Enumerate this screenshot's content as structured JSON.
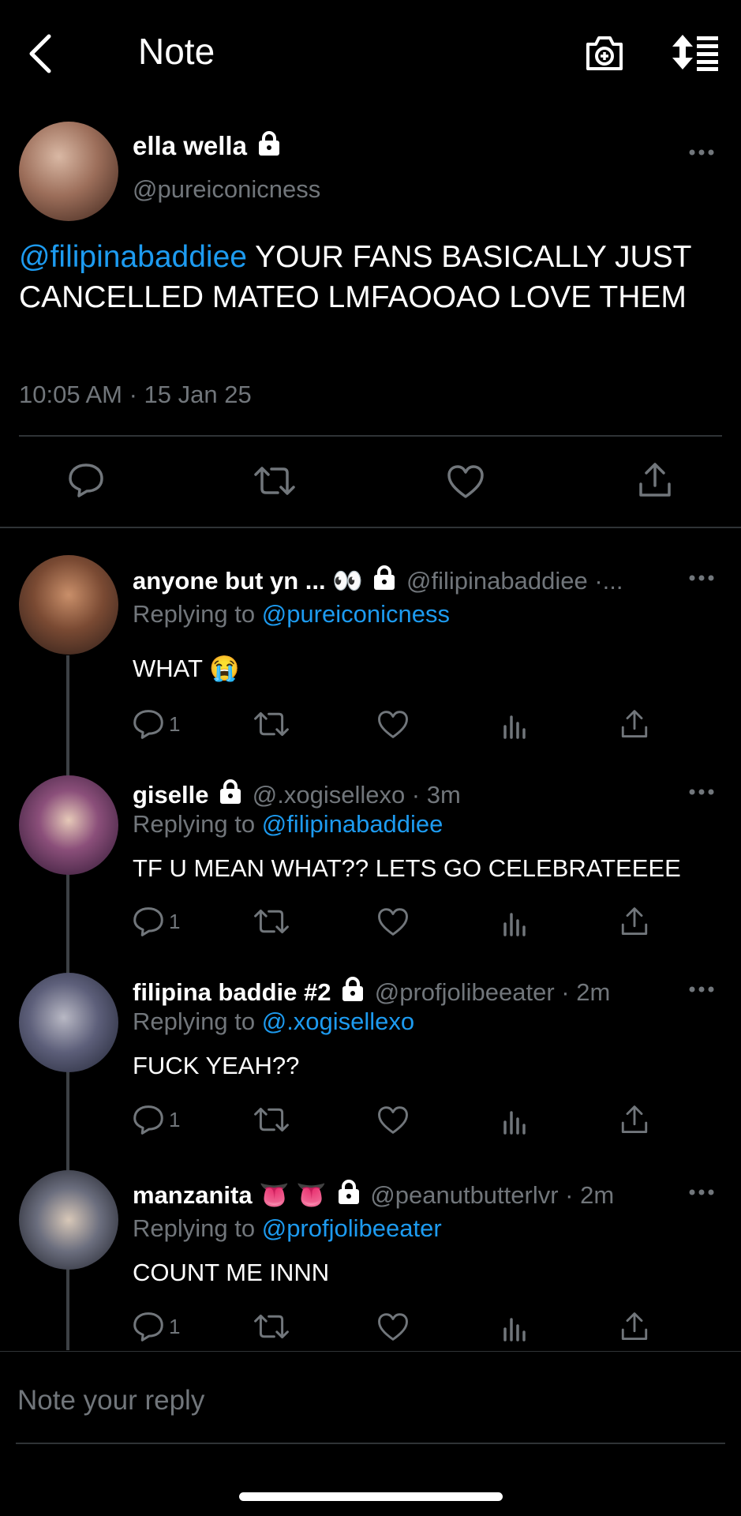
{
  "header": {
    "title": "Note",
    "back_icon": "chevron-left-icon",
    "camera_icon": "camera-plus-icon",
    "sort_icon": "sort-list-icon"
  },
  "main_tweet": {
    "name": "ella wella",
    "handle": "@pureiconicness",
    "mention": "@filipinabaddiee",
    "text": " YOUR FANS BASICALLY JUST CANCELLED MATEO LMFAOOAO LOVE THEM",
    "timestamp": "10:05 AM · 15 Jan 25"
  },
  "replies": [
    {
      "name": "anyone but yn ... 👀",
      "handle": "@filipinabaddiee ·...",
      "replying_prefix": "Replying to ",
      "replying_to": "@pureiconicness",
      "text": "WHAT 😭",
      "reply_count": "1"
    },
    {
      "name": "giselle",
      "handle": "@.xogisellexo · 3m",
      "replying_prefix": "Replying to ",
      "replying_to": "@filipinabaddiee",
      "text": "TF U MEAN WHAT?? LETS GO CELEBRATEEEE",
      "reply_count": "1"
    },
    {
      "name": "filipina baddie #2",
      "handle": "@profjolibeeater · 2m",
      "replying_prefix": "Replying to ",
      "replying_to": "@.xogisellexo",
      "text": "FUCK YEAH??",
      "reply_count": "1"
    },
    {
      "name": "manzanita 👅 👅",
      "handle": "@peanutbutterlvr · 2m",
      "replying_prefix": "Replying to ",
      "replying_to": "@profjolibeeater",
      "text": "COUNT ME INNN",
      "reply_count": "1"
    }
  ],
  "reply_bar": {
    "placeholder": "Note your reply"
  },
  "colors": {
    "background": "#000000",
    "accent": "#1d9bf0",
    "secondary_text": "#71767b",
    "divider": "#2f3336"
  }
}
